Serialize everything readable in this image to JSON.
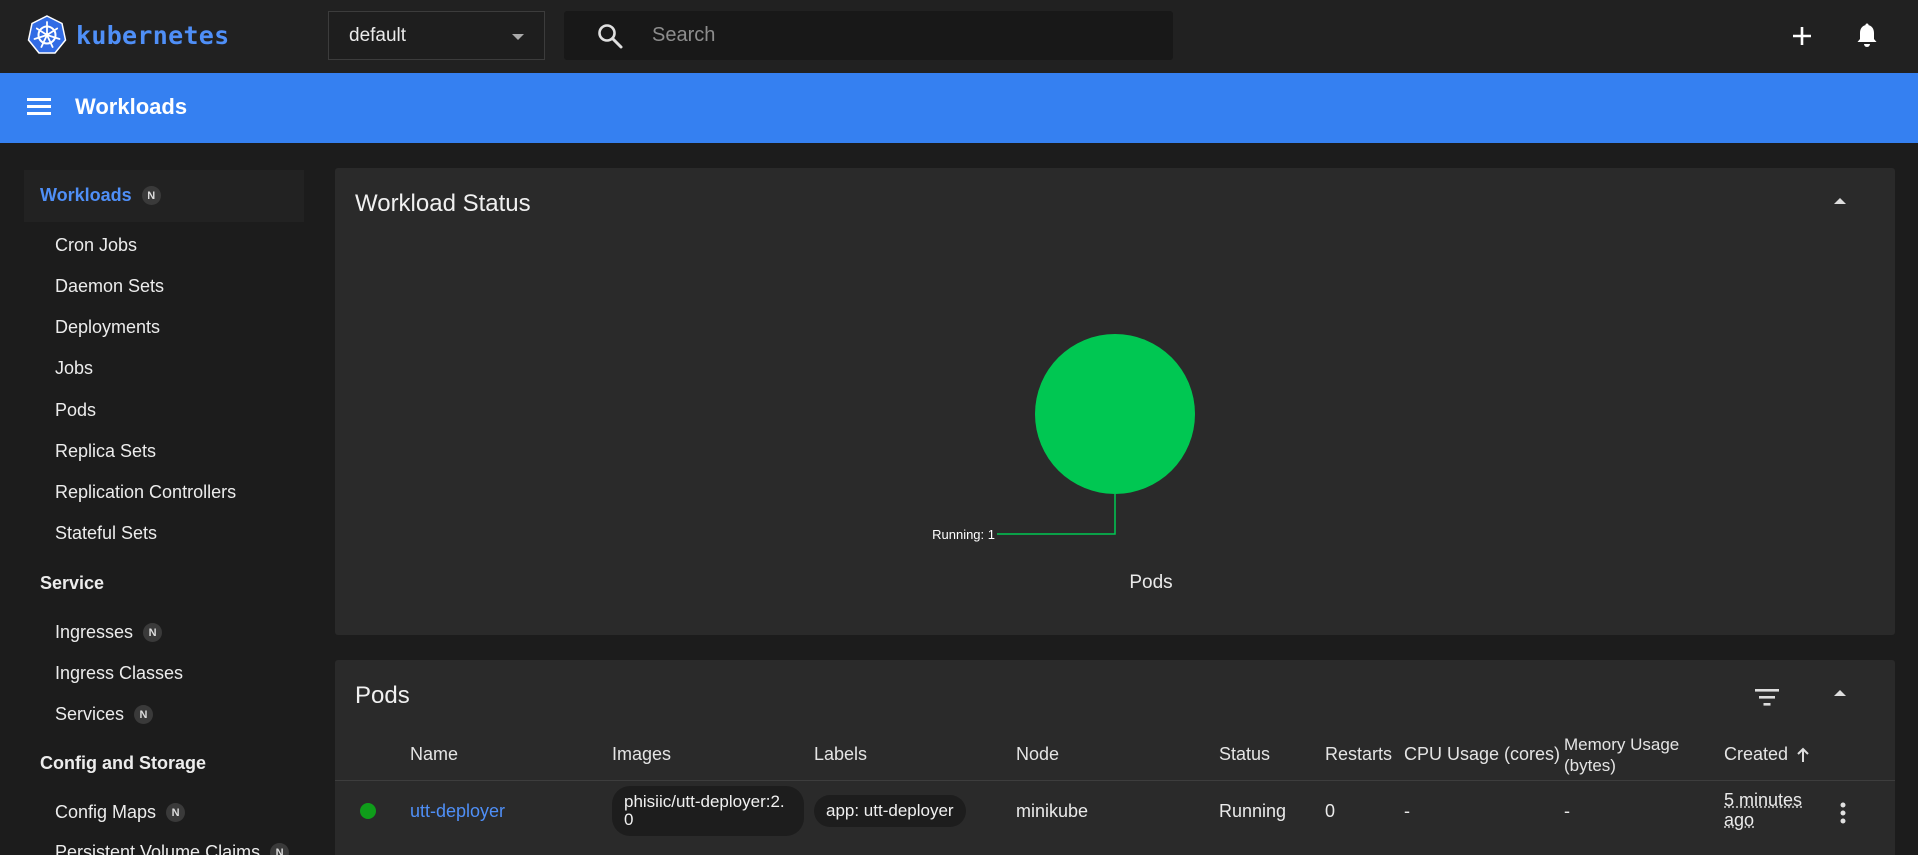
{
  "brand": {
    "name": "kubernetes",
    "color": "#4f8ff7"
  },
  "header": {
    "namespace": "default",
    "search_placeholder": "Search",
    "icons": {
      "search": "search-icon",
      "create": "plus-icon",
      "notifications": "bell-icon"
    }
  },
  "appbar": {
    "title": "Workloads",
    "menu_icon": "hamburger-menu-icon",
    "color": "#3580f1"
  },
  "sidebar": {
    "workloads": {
      "label": "Workloads",
      "badge": "N"
    },
    "workload_items": [
      "Cron Jobs",
      "Daemon Sets",
      "Deployments",
      "Jobs",
      "Pods",
      "Replica Sets",
      "Replication Controllers",
      "Stateful Sets"
    ],
    "service": {
      "label": "Service"
    },
    "service_items": [
      {
        "label": "Ingresses",
        "badge": "N"
      },
      {
        "label": "Ingress Classes"
      },
      {
        "label": "Services",
        "badge": "N"
      }
    ],
    "config": {
      "label": "Config and Storage"
    },
    "config_items": [
      {
        "label": "Config Maps",
        "badge": "N"
      },
      {
        "label": "Persistent Volume Claims",
        "badge": "N"
      }
    ]
  },
  "workload_status": {
    "title": "Workload Status",
    "chart_label": "Pods"
  },
  "chart_data": {
    "type": "pie",
    "title": "Pods",
    "categories": [
      "Running"
    ],
    "values": [
      1
    ],
    "labels": [
      "Running: 1"
    ],
    "colors": [
      "#00c752"
    ]
  },
  "pods": {
    "title": "Pods",
    "columns": [
      "Name",
      "Images",
      "Labels",
      "Node",
      "Status",
      "Restarts",
      "CPU Usage (cores)",
      "Memory Usage (bytes)",
      "Created"
    ],
    "rows": [
      {
        "status_color": "#0f9d1a",
        "name": "utt-deployer",
        "image": "phisiic/utt-deployer:2.0",
        "label": "app: utt-deployer",
        "node": "minikube",
        "status": "Running",
        "restarts": "0",
        "cpu": "-",
        "memory": "-",
        "created": "5 minutes ago"
      }
    ]
  }
}
